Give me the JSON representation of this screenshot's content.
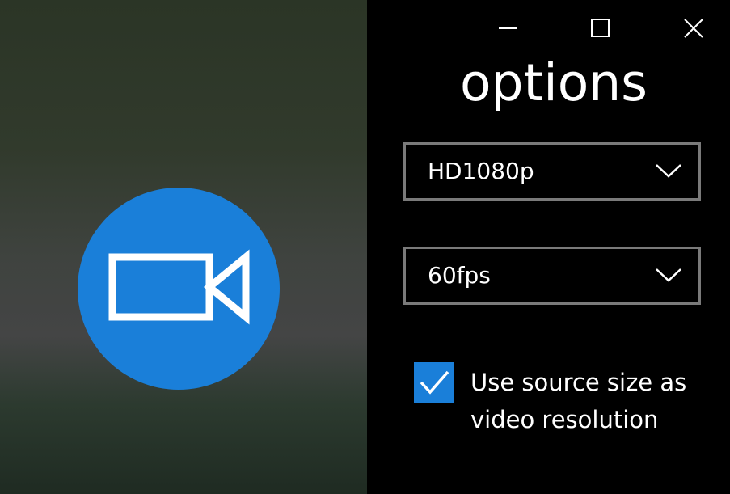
{
  "window": {
    "minimize_icon": "minimize-icon",
    "maximize_icon": "maximize-icon",
    "close_icon": "close-icon"
  },
  "preview": {
    "record_icon": "video-camera-icon",
    "accent_color": "#1a7fd9"
  },
  "options": {
    "title": "options",
    "resolution": {
      "selected": "HD1080p",
      "icon": "chevron-down-icon"
    },
    "framerate": {
      "selected": "60fps",
      "icon": "chevron-down-icon"
    },
    "use_source_size": {
      "checked": true,
      "label_line1": "Use source size as",
      "label_line2": "video resolution",
      "icon": "checkmark-icon"
    }
  }
}
